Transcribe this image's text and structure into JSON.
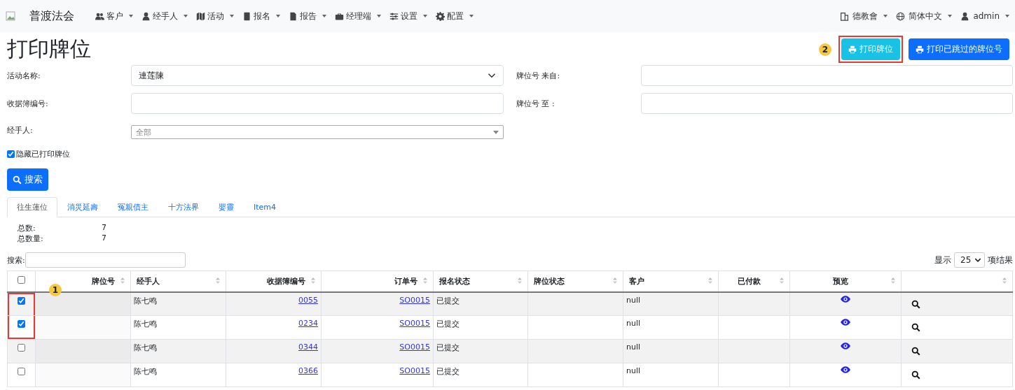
{
  "navbar": {
    "brand": "普渡法会",
    "menus": [
      {
        "label": "客户"
      },
      {
        "label": "经手人"
      },
      {
        "label": "活动"
      },
      {
        "label": "报名"
      },
      {
        "label": "报告"
      },
      {
        "label": "经理端"
      },
      {
        "label": "设置"
      },
      {
        "label": "配置"
      }
    ],
    "right_menus": [
      {
        "label": "德教會"
      },
      {
        "label": "简体中文"
      },
      {
        "label": "admin"
      }
    ]
  },
  "page_title": "打印牌位",
  "header_buttons": [
    {
      "label": "打印牌位",
      "kind": "info",
      "callout": "2",
      "highlighted": true
    },
    {
      "label": "打印已跳过的牌位号",
      "kind": "primary",
      "highlighted": false
    }
  ],
  "filters": [
    {
      "label": "活动名称:",
      "kind": "select",
      "value": "連莲陳"
    },
    {
      "label": "牌位号 来自:",
      "kind": "text"
    },
    {
      "label": "收据簿编号:",
      "kind": "text"
    },
    {
      "label": "牌位号 至 :",
      "kind": "text"
    },
    {
      "label": "经手人:",
      "kind": "combo",
      "placeholder": "全部"
    }
  ],
  "hide_printed": {
    "label": "隐藏已打印牌位",
    "checked": true
  },
  "search_button": "搜索",
  "tabs": [
    {
      "label": "往生蓮位",
      "selected": true
    },
    {
      "label": "消災延壽",
      "selected": false
    },
    {
      "label": "冤親債主",
      "selected": false
    },
    {
      "label": "十方法界",
      "selected": false
    },
    {
      "label": "嬰靈",
      "selected": false
    },
    {
      "label": "Item4",
      "selected": false
    }
  ],
  "totals": [
    {
      "label": "总数:",
      "value": "7"
    },
    {
      "label": "总数量:",
      "value": "7"
    }
  ],
  "table_search": {
    "label": "搜索:"
  },
  "page_size": {
    "before": "显示",
    "value": "25",
    "after": "项结果"
  },
  "table": {
    "select_all": false,
    "callout": "1",
    "columns": [
      "牌位号",
      "经手人",
      "收据簿编号",
      "订单号",
      "报名状态",
      "牌位状态",
      "客户",
      "已付款",
      "预览"
    ],
    "rows": [
      {
        "checked": true,
        "highlighted": true,
        "handler": "陈七鸣",
        "receipt": "0055",
        "order": "SO0015",
        "status": "已提交",
        "customer": "null"
      },
      {
        "checked": true,
        "highlighted": true,
        "handler": "陈七鸣",
        "receipt": "0234",
        "order": "SO0015",
        "status": "已提交",
        "customer": "null"
      },
      {
        "checked": false,
        "highlighted": false,
        "handler": "陈七鸣",
        "receipt": "0344",
        "order": "SO0015",
        "status": "已提交",
        "customer": "null"
      },
      {
        "checked": false,
        "highlighted": false,
        "handler": "陈七鸣",
        "receipt": "0366",
        "order": "SO0015",
        "status": "已提交",
        "customer": "null"
      }
    ]
  }
}
